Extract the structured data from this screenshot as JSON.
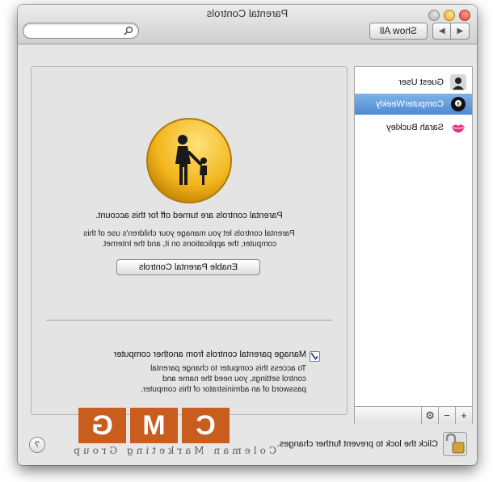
{
  "window": {
    "title": "Parental Controls"
  },
  "toolbar": {
    "back": "◀",
    "forward": "▶",
    "show_all": "Show All",
    "search_placeholder": "",
    "search_value": ""
  },
  "users": [
    {
      "name": "Guest User",
      "selected": false,
      "avatar": "person-silhouette-icon"
    },
    {
      "name": "ComputerWeekly",
      "selected": true,
      "avatar": "eight-ball-icon"
    },
    {
      "name": "Sarah Buckley",
      "selected": false,
      "avatar": "lips-icon"
    }
  ],
  "sidebar_buttons": {
    "add": "+",
    "remove": "−",
    "gear": "⚙"
  },
  "main": {
    "headline": "Parental controls are turned off for this account.",
    "description": "Parental controls let you manage your children's use of this computer, the applications on it, and the Internet.",
    "enable_button": "Enable Parental Controls",
    "remote_checkbox_checked": true,
    "remote_title": "Manage parental controls from another computer",
    "remote_description": "To access this computer to change parental control settings, you need the name and password of an administrator of this computer."
  },
  "footer": {
    "lock_text": "Click the lock to prevent further changes.",
    "help": "?"
  },
  "watermark": {
    "letters": [
      "C",
      "M",
      "G"
    ],
    "text": "Coleman Marketing Group",
    "color": "#c95d1e"
  }
}
